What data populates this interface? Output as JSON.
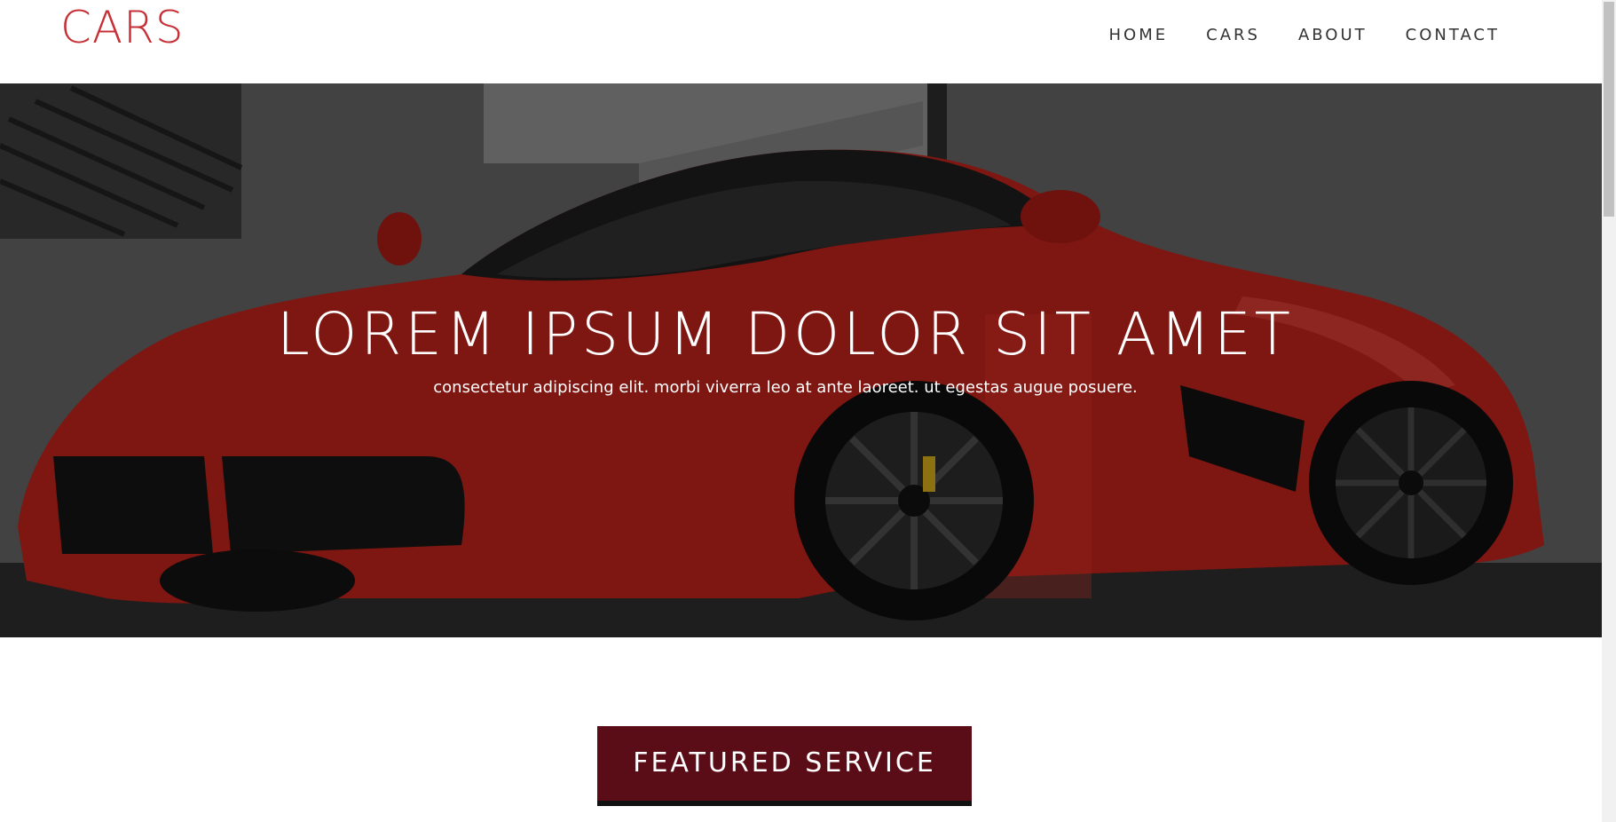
{
  "header": {
    "logo": "CARS",
    "nav": [
      "HOME",
      "CARS",
      "ABOUT",
      "CONTACT"
    ]
  },
  "hero": {
    "title": "LOREM IPSUM DOLOR SIT AMET",
    "subtitle": "consectetur adipiscing elit. morbi viverra leo at ante laoreet. ut egestas augue posuere."
  },
  "featured": {
    "button_label": "FEATURED SERVICE"
  },
  "colors": {
    "brand": "#c62f35",
    "featured_bg": "#5b0d17",
    "hero_car": "#c0231d"
  },
  "icons": {
    "hero_image": "sports-car-photo"
  }
}
